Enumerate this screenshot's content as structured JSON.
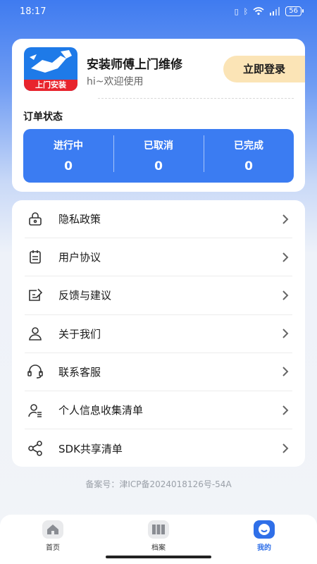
{
  "statusbar": {
    "time": "18:17",
    "battery": "56"
  },
  "profile": {
    "logo_banner": "上门安装",
    "app_name": "安装师傅上门维修",
    "welcome": "hi~欢迎使用",
    "login_label": "立即登录"
  },
  "orders": {
    "title": "订单状态",
    "items": [
      {
        "label": "进行中",
        "count": "0"
      },
      {
        "label": "已取消",
        "count": "0"
      },
      {
        "label": "已完成",
        "count": "0"
      }
    ]
  },
  "menu": {
    "items": [
      {
        "label": "隐私政策",
        "icon": "lock-icon"
      },
      {
        "label": "用户协议",
        "icon": "document-icon"
      },
      {
        "label": "反馈与建议",
        "icon": "edit-icon"
      },
      {
        "label": "关于我们",
        "icon": "user-icon"
      },
      {
        "label": "联系客服",
        "icon": "headset-icon"
      },
      {
        "label": "个人信息收集清单",
        "icon": "user-list-icon"
      },
      {
        "label": "SDK共享清单",
        "icon": "share-icon"
      }
    ]
  },
  "footer": {
    "beian": "备案号：津ICP备2024018126号-54A"
  },
  "tabbar": {
    "items": [
      {
        "label": "首页",
        "icon": "home-icon",
        "active": false
      },
      {
        "label": "档案",
        "icon": "archive-icon",
        "active": false
      },
      {
        "label": "我的",
        "icon": "profile-icon",
        "active": true
      }
    ]
  },
  "colors": {
    "primary": "#3b7cf2",
    "login_bg": "#fbe4b6",
    "accent_red": "#e8242d"
  }
}
